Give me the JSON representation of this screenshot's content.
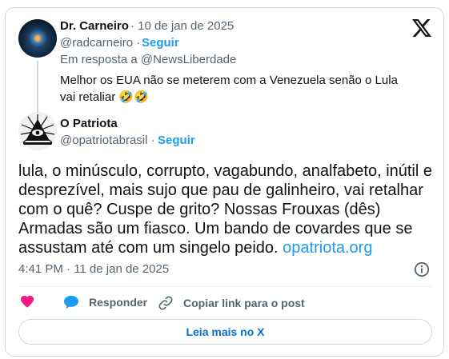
{
  "parent_tweet": {
    "author_name": "Dr. Carneiro",
    "date": "· 10 de jan de 2025",
    "handle": "@radcarneiro ·",
    "follow_label": "Seguir",
    "reply_to": "Em resposta a @NewsLiberdade",
    "text": "Melhor os EUA não se meterem com a Venezuela senão o Lula vai retaliar 🤣🤣"
  },
  "main_tweet": {
    "author_name": "O Patriota",
    "handle": "@opatriotabrasil ·",
    "follow_label": "Seguir",
    "text": "lula, o minúsculo, corrupto, vagabundo, analfabeto, inútil e desprezível, mais sujo que pau de galinheiro, vai retalhar com o quê? Cuspe de grito? Nossas Frouxas (dês) Armadas são um fiasco. Um bando de covardes que se assustam até com um singelo peido.",
    "link_text": "opatriota.org",
    "timestamp": "4:41 PM · 11 de jan de 2025"
  },
  "actions": {
    "like_label": "",
    "reply_label": "Responder",
    "copy_label": "Copiar link para o post"
  },
  "read_more_label": "Leia mais no X",
  "icons": {
    "brand": "x-logo-icon",
    "like": "heart-icon",
    "reply": "speech-bubble-icon",
    "copy": "link-icon",
    "info": "info-icon"
  },
  "colors": {
    "accent": "#1d9bf0",
    "like": "#f91880",
    "muted": "#536471",
    "read_more": "#006fd6"
  }
}
